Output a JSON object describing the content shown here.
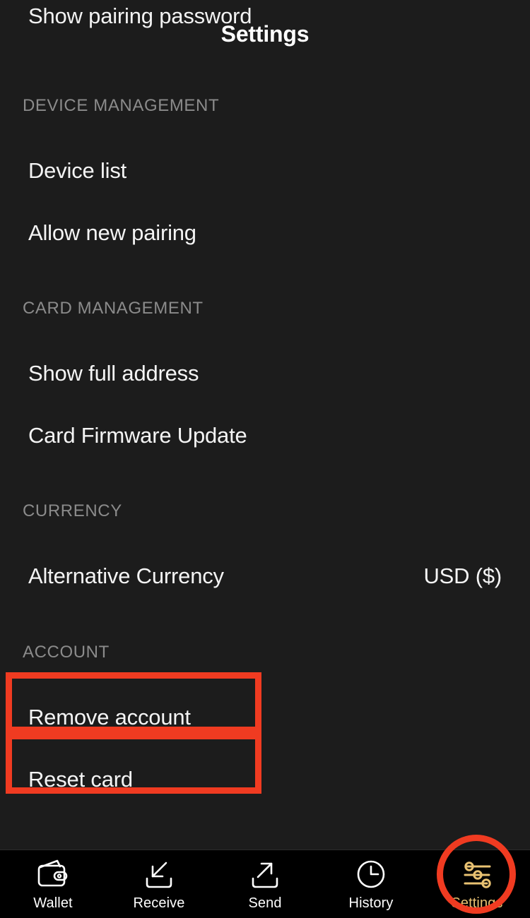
{
  "header": {
    "title": "Settings",
    "residual_label": "Show pairing password"
  },
  "sections": [
    {
      "id": "device-management",
      "header": "DEVICE MANAGEMENT",
      "rows": [
        {
          "label": "Device list",
          "value": ""
        },
        {
          "label": "Allow new pairing",
          "value": ""
        }
      ]
    },
    {
      "id": "card-management",
      "header": "CARD MANAGEMENT",
      "rows": [
        {
          "label": "Show full address",
          "value": ""
        },
        {
          "label": "Card Firmware Update",
          "value": ""
        }
      ]
    },
    {
      "id": "currency",
      "header": "CURRENCY",
      "rows": [
        {
          "label": "Alternative Currency",
          "value": "USD ($)"
        }
      ]
    },
    {
      "id": "account",
      "header": "ACCOUNT",
      "rows": [
        {
          "label": "Remove account",
          "value": ""
        },
        {
          "label": "Reset card",
          "value": ""
        }
      ]
    }
  ],
  "bottom_nav": {
    "items": [
      {
        "label": "Wallet",
        "icon": "wallet-icon",
        "active": false
      },
      {
        "label": "Receive",
        "icon": "receive-icon",
        "active": false
      },
      {
        "label": "Send",
        "icon": "send-icon",
        "active": false
      },
      {
        "label": "History",
        "icon": "clock-icon",
        "active": false
      },
      {
        "label": "Settings",
        "icon": "sliders-icon",
        "active": true
      }
    ]
  },
  "annotations": {
    "highlight_color": "#f03b21",
    "boxes": [
      {
        "target": "Remove account"
      },
      {
        "target": "Reset card"
      },
      {
        "target": "Settings"
      }
    ]
  },
  "colors": {
    "background": "#1c1c1c",
    "nav_background": "#000000",
    "text_primary": "#f4f4f4",
    "text_section": "#8b8b8b",
    "accent_gold": "#e9c272",
    "highlight_red": "#f03b21"
  }
}
